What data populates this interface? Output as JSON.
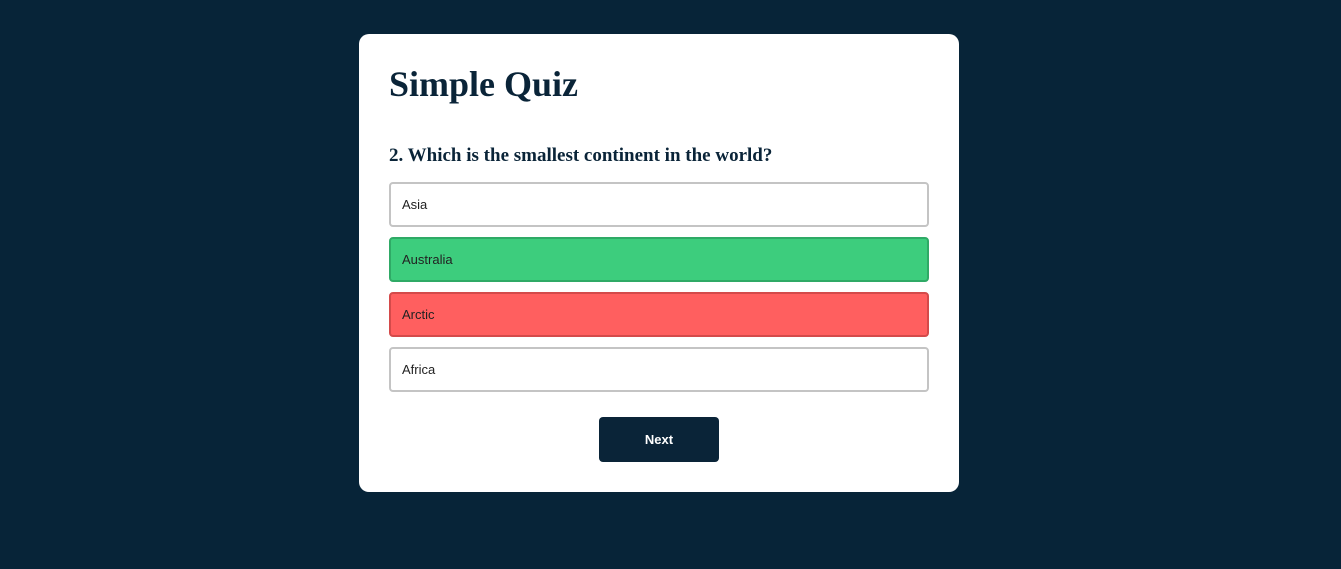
{
  "quiz": {
    "title": "Simple Quiz",
    "question": "2. Which is the smallest continent in the world?",
    "answers": [
      {
        "label": "Asia",
        "state": "neutral"
      },
      {
        "label": "Australia",
        "state": "correct"
      },
      {
        "label": "Arctic",
        "state": "incorrect"
      },
      {
        "label": "Africa",
        "state": "neutral"
      }
    ],
    "next_label": "Next"
  },
  "colors": {
    "background": "#072438",
    "card": "#ffffff",
    "primary": "#0a2438",
    "correct": "#3dcd7d",
    "incorrect": "#ff5f5f"
  }
}
